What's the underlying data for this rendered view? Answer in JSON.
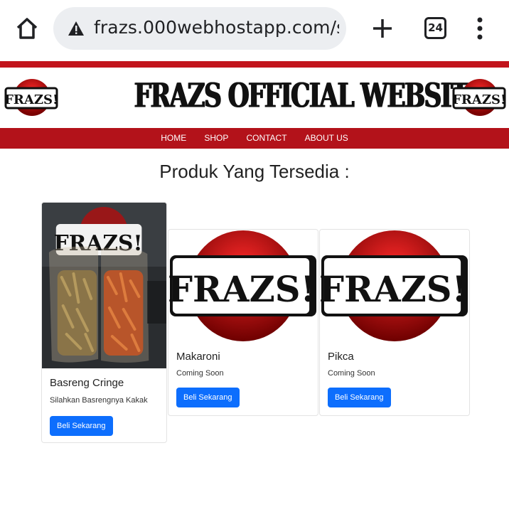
{
  "browser": {
    "url": "frazs.000webhostapp.com/s",
    "tab_count": "24"
  },
  "header": {
    "logo_text": "FRAZS!",
    "title": "FRAZS OFFICIAL WEBSITE"
  },
  "nav": {
    "items": [
      "HOME",
      "SHOP",
      "CONTACT",
      "ABOUT US"
    ]
  },
  "main": {
    "section_title": "Produk Yang Tersedia :",
    "products": [
      {
        "name": "Basreng Cringe",
        "description": "Silahkan Basrengnya Kakak",
        "button": "Beli Sekarang"
      },
      {
        "name": "Makaroni",
        "description": "Coming Soon",
        "button": "Beli Sekarang"
      },
      {
        "name": "Pikca",
        "description": "Coming Soon",
        "button": "Beli Sekarang"
      }
    ]
  },
  "colors": {
    "brand_red": "#c2141c",
    "nav_red": "#b3121a",
    "button_blue": "#0d6efd"
  }
}
